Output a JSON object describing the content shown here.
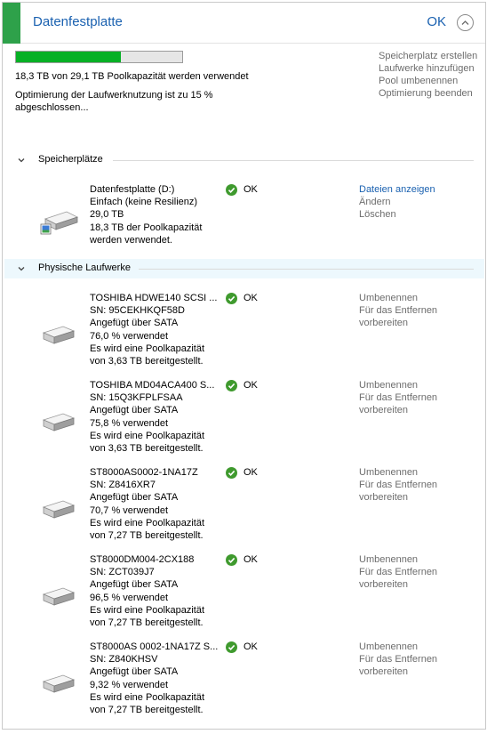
{
  "header": {
    "title": "Datenfestplatte",
    "ok_label": "OK"
  },
  "pool": {
    "progress": 0.63,
    "usage_text": "18,3 TB von 29,1 TB Poolkapazität werden verwendet",
    "optimization_text": "Optimierung der Laufwerknutzung ist zu 15 % abgeschlossen..."
  },
  "top_actions": [
    "Speicherplatz erstellen",
    "Laufwerke hinzufügen",
    "Pool umbenennen",
    "Optimierung beenden"
  ],
  "sections": {
    "spaces": "Speicherplätze",
    "physical": "Physische Laufwerke"
  },
  "space": {
    "lines": [
      "Datenfestplatte (D:)",
      "Einfach (keine Resilienz)",
      "29,0 TB",
      "18,3 TB der Poolkapazität",
      "werden verwendet."
    ],
    "status": "OK",
    "actions": [
      "Dateien anzeigen",
      "Ändern",
      "Löschen"
    ]
  },
  "drive_actions": [
    "Umbenennen",
    "Für das Entfernen",
    "vorbereiten"
  ],
  "drives": [
    {
      "lines": [
        "TOSHIBA HDWE140 SCSI ...",
        "SN: 95CEKHKQF58D",
        "Angefügt über SATA",
        "76,0 % verwendet",
        "Es wird eine Poolkapazität",
        "von 3,63 TB bereitgestellt."
      ],
      "status": "OK"
    },
    {
      "lines": [
        "TOSHIBA MD04ACA400 S...",
        "SN: 15Q3KFPLFSAA",
        "Angefügt über SATA",
        "75,8 % verwendet",
        "Es wird eine Poolkapazität",
        "von 3,63 TB bereitgestellt."
      ],
      "status": "OK"
    },
    {
      "lines": [
        "ST8000AS0002-1NA17Z",
        "SN: Z8416XR7",
        "Angefügt über SATA",
        "70,7 % verwendet",
        "Es wird eine Poolkapazität",
        "von 7,27 TB bereitgestellt."
      ],
      "status": "OK"
    },
    {
      "lines": [
        "ST8000DM004-2CX188",
        "SN: ZCT039J7",
        "Angefügt über SATA",
        "96,5 % verwendet",
        "Es wird eine Poolkapazität",
        "von 7,27 TB bereitgestellt."
      ],
      "status": "OK"
    },
    {
      "lines": [
        "ST8000AS 0002-1NA17Z S...",
        "SN: Z840KHSV",
        "Angefügt über SATA",
        "9,32 % verwendet",
        "Es wird eine Poolkapazität",
        "von 7,27 TB bereitgestellt."
      ],
      "status": "OK"
    }
  ],
  "colors": {
    "accent": "#2ea14a",
    "progress": "#06b025",
    "link": "#1a61b0",
    "muted": "#6d6d6d",
    "ok_check": "#3f9a2e"
  },
  "icons": [
    "chevron-up-icon",
    "chevron-down-icon",
    "check-icon",
    "hard-drive-icon",
    "storage-space-icon"
  ]
}
